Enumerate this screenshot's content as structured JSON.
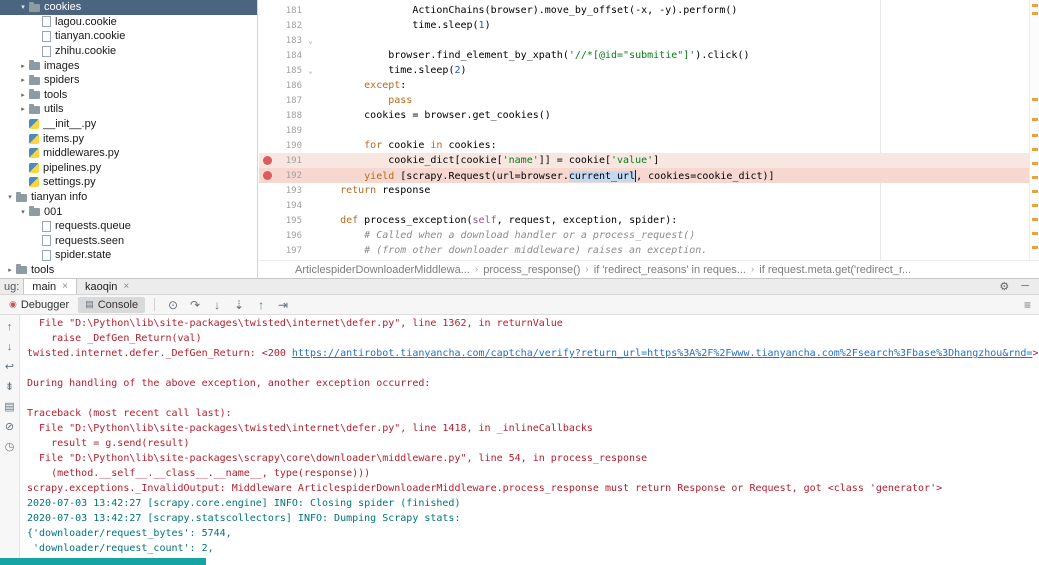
{
  "colors": {
    "tree_selection": "#4b6480",
    "breakpoint_line": "#f8e7e1",
    "breakpoint_line_active": "#f6d8d1",
    "breakpoint_dot": "#db5c5c",
    "keyword": "#b96a1c",
    "string": "#067d17",
    "number": "#1750eb",
    "comment": "#8c8c8c",
    "self_param": "#94558d",
    "selected_word_bg": "#c2d9f0",
    "error_text": "#b21f2d",
    "info_text": "#00757a",
    "link_text": "#2470c8",
    "warning_tick": "#e8a33d",
    "taskbar_strip": "#16a3a3"
  },
  "sidebar": {
    "items": [
      {
        "label": "cookies",
        "icon": "folder",
        "indent": 1,
        "arrow": "expanded",
        "selected": true
      },
      {
        "label": "lagou.cookie",
        "icon": "file",
        "indent": 2
      },
      {
        "label": "tianyan.cookie",
        "icon": "file",
        "indent": 2
      },
      {
        "label": "zhihu.cookie",
        "icon": "file",
        "indent": 2
      },
      {
        "label": "images",
        "icon": "folder",
        "indent": 1,
        "arrow": "collapsed"
      },
      {
        "label": "spiders",
        "icon": "folder",
        "indent": 1,
        "arrow": "collapsed"
      },
      {
        "label": "tools",
        "icon": "folder",
        "indent": 1,
        "arrow": "collapsed"
      },
      {
        "label": "utils",
        "icon": "folder",
        "indent": 1,
        "arrow": "collapsed"
      },
      {
        "label": "__init__.py",
        "icon": "py",
        "indent": 1
      },
      {
        "label": "items.py",
        "icon": "py",
        "indent": 1
      },
      {
        "label": "middlewares.py",
        "icon": "py",
        "indent": 1
      },
      {
        "label": "pipelines.py",
        "icon": "py",
        "indent": 1
      },
      {
        "label": "settings.py",
        "icon": "py",
        "indent": 1
      },
      {
        "label": "tianyan info",
        "icon": "folder",
        "indent": 0,
        "arrow": "expanded"
      },
      {
        "label": "001",
        "icon": "folder",
        "indent": 1,
        "arrow": "expanded"
      },
      {
        "label": "requests.queue",
        "icon": "file",
        "indent": 2
      },
      {
        "label": "requests.seen",
        "icon": "file",
        "indent": 2
      },
      {
        "label": "spider.state",
        "icon": "file",
        "indent": 2
      },
      {
        "label": "tools",
        "icon": "folder",
        "indent": 0,
        "arrow": "collapsed"
      }
    ]
  },
  "editor": {
    "lines": [
      {
        "num": 181,
        "indent": 16,
        "tokens": [
          [
            "ActionChains(browser).move_by_offset(-x, -y).perform()",
            "pl"
          ]
        ]
      },
      {
        "num": 182,
        "indent": 16,
        "tokens": [
          [
            "time.sleep(",
            "pl"
          ],
          [
            "1",
            "num"
          ],
          [
            ")",
            "pl"
          ]
        ]
      },
      {
        "num": 183,
        "indent": 0,
        "tokens": [],
        "fold": true
      },
      {
        "num": 184,
        "indent": 12,
        "tokens": [
          [
            "browser.find_element_by_xpath(",
            "pl"
          ],
          [
            "'//*[@id=\"submitie\"]'",
            "str"
          ],
          [
            ").click()",
            "pl"
          ]
        ]
      },
      {
        "num": 185,
        "indent": 12,
        "tokens": [
          [
            "time.sleep(",
            "pl"
          ],
          [
            "2",
            "num"
          ],
          [
            ")",
            "pl"
          ]
        ],
        "fold": true
      },
      {
        "num": 186,
        "indent": 8,
        "tokens": [
          [
            "except",
            "kw"
          ],
          [
            ":",
            "pl"
          ]
        ]
      },
      {
        "num": 187,
        "indent": 12,
        "tokens": [
          [
            "pass",
            "kw"
          ]
        ]
      },
      {
        "num": 188,
        "indent": 8,
        "tokens": [
          [
            "cookies = browser.get_cookies()",
            "pl"
          ]
        ]
      },
      {
        "num": 189,
        "indent": 0,
        "tokens": []
      },
      {
        "num": 190,
        "indent": 8,
        "tokens": [
          [
            "for",
            "kw"
          ],
          [
            " cookie ",
            "pl"
          ],
          [
            "in",
            "kw"
          ],
          [
            " cookies:",
            "pl"
          ]
        ]
      },
      {
        "num": 191,
        "indent": 12,
        "bg": "bp1",
        "breakpoint": true,
        "tokens": [
          [
            "cookie_dict[cookie[",
            "pl"
          ],
          [
            "'name'",
            "str"
          ],
          [
            "]] = cookie[",
            "pl"
          ],
          [
            "'value'",
            "str"
          ],
          [
            "]",
            "pl"
          ]
        ]
      },
      {
        "num": 192,
        "indent": 8,
        "bg": "bp2",
        "breakpoint": true,
        "caret": true,
        "tokens": [
          [
            "yield",
            "kw"
          ],
          [
            " [scrapy.Request(url=browser.",
            "pl"
          ],
          [
            "current_url",
            "selword"
          ],
          [
            ", cookies=cookie_dict)]",
            "pl"
          ]
        ]
      },
      {
        "num": 193,
        "indent": 4,
        "tokens": [
          [
            "return",
            "kw"
          ],
          [
            " response",
            "pl"
          ]
        ]
      },
      {
        "num": 194,
        "indent": 0,
        "tokens": []
      },
      {
        "num": 195,
        "indent": 4,
        "tokens": [
          [
            "def",
            "kw"
          ],
          [
            " process_exception(",
            "pl"
          ],
          [
            "self",
            "self"
          ],
          [
            ", request, exception, spider):",
            "pl"
          ]
        ]
      },
      {
        "num": 196,
        "indent": 8,
        "tokens": [
          [
            "# Called when a download handler or a process_request()",
            "com"
          ]
        ]
      },
      {
        "num": 197,
        "indent": 8,
        "tokens": [
          [
            "# (from other downloader middleware) raises an exception.",
            "com"
          ]
        ]
      }
    ],
    "stripe_ticks": [
      4,
      12,
      98,
      118,
      134,
      148,
      162,
      176,
      190,
      204,
      218,
      232,
      246
    ]
  },
  "breadcrumbs": {
    "items": [
      "ArticlespiderDownloaderMiddlewa...",
      "process_response()",
      "if 'redirect_reasons' in reques...",
      "if request.meta.get('redirect_r..."
    ],
    "separator": "›"
  },
  "debug": {
    "prefix": "ug:",
    "close_glyph": "×",
    "tabs": [
      {
        "label": "main",
        "selected": true
      },
      {
        "label": "kaoqin",
        "selected": false
      }
    ],
    "header_icons": [
      {
        "name": "settings-gear-icon",
        "glyph": "⚙"
      },
      {
        "name": "hide-window-icon",
        "glyph": "─"
      }
    ],
    "panel_tabs": [
      {
        "label": "Debugger",
        "icon": "debugger-icon",
        "glyph": "◉",
        "glyph_color": "#c05555",
        "selected": false
      },
      {
        "label": "Console",
        "icon": "console-icon",
        "glyph": "▤",
        "glyph_color": "#607080",
        "selected": true
      }
    ],
    "actions": [
      {
        "name": "show-execution-point-icon",
        "glyph": "⊙"
      },
      {
        "name": "step-over-icon",
        "glyph": "↷"
      },
      {
        "name": "step-into-icon",
        "glyph": "↓"
      },
      {
        "name": "force-step-into-icon",
        "glyph": "⇣"
      },
      {
        "name": "step-out-icon",
        "glyph": "↑"
      },
      {
        "name": "run-to-cursor-icon",
        "glyph": "⇥"
      }
    ],
    "right_icon": {
      "name": "console-menu-icon",
      "glyph": "≡"
    },
    "strip_icons": [
      {
        "name": "up-stack-trace-icon",
        "glyph": "↑"
      },
      {
        "name": "down-stack-trace-icon",
        "glyph": "↓"
      },
      {
        "name": "soft-wrap-icon",
        "glyph": "↩"
      },
      {
        "name": "scroll-to-end-icon",
        "glyph": "⇟"
      },
      {
        "name": "print-icon",
        "glyph": "▤"
      },
      {
        "name": "clear-console-icon",
        "glyph": "⊘"
      },
      {
        "name": "history-icon",
        "glyph": "◷"
      }
    ]
  },
  "console": {
    "lines": [
      [
        [
          "  File \"D:\\Python\\lib\\site-packages\\twisted\\internet\\defer.py\", line 1362, in returnValue",
          "err"
        ]
      ],
      [
        [
          "    raise _DefGen_Return(val)",
          "err"
        ]
      ],
      [
        [
          "twisted.internet.defer._DefGen_Return: <200 ",
          "err"
        ],
        [
          "https://antirobot.tianyancha.com/captcha/verify?return_url=https%3A%2F%2Fwww.tianyancha.com%2Fsearch%3Fbase%3Dhangzhou&rnd=",
          "link"
        ],
        [
          ">",
          "err"
        ]
      ],
      [],
      [
        [
          "During handling of the above exception, another exception occurred:",
          "err"
        ]
      ],
      [],
      [
        [
          "Traceback (most recent call last):",
          "err"
        ]
      ],
      [
        [
          "  File \"D:\\Python\\lib\\site-packages\\twisted\\internet\\defer.py\", line 1418, in _inlineCallbacks",
          "err"
        ]
      ],
      [
        [
          "    result = g.send(result)",
          "err"
        ]
      ],
      [
        [
          "  File \"D:\\Python\\lib\\site-packages\\scrapy\\core\\downloader\\middleware.py\", line 54, in process_response",
          "err"
        ]
      ],
      [
        [
          "    (method.__self__.__class__.__name__, type(response)))",
          "err"
        ]
      ],
      [
        [
          "scrapy.exceptions._InvalidOutput: Middleware ArticlespiderDownloaderMiddleware.process_response must return Response or Request, got <class 'generator'>",
          "err"
        ]
      ],
      [
        [
          "2020-07-03 13:42:27 [scrapy.core.engine] INFO: Closing spider (finished)",
          "info"
        ]
      ],
      [
        [
          "2020-07-03 13:42:27 [scrapy.statscollectors] INFO: Dumping Scrapy stats:",
          "info"
        ]
      ],
      [
        [
          "{'downloader/request_bytes': 5744,",
          "info"
        ]
      ],
      [
        [
          " 'downloader/request_count': 2,",
          "info"
        ]
      ]
    ]
  }
}
